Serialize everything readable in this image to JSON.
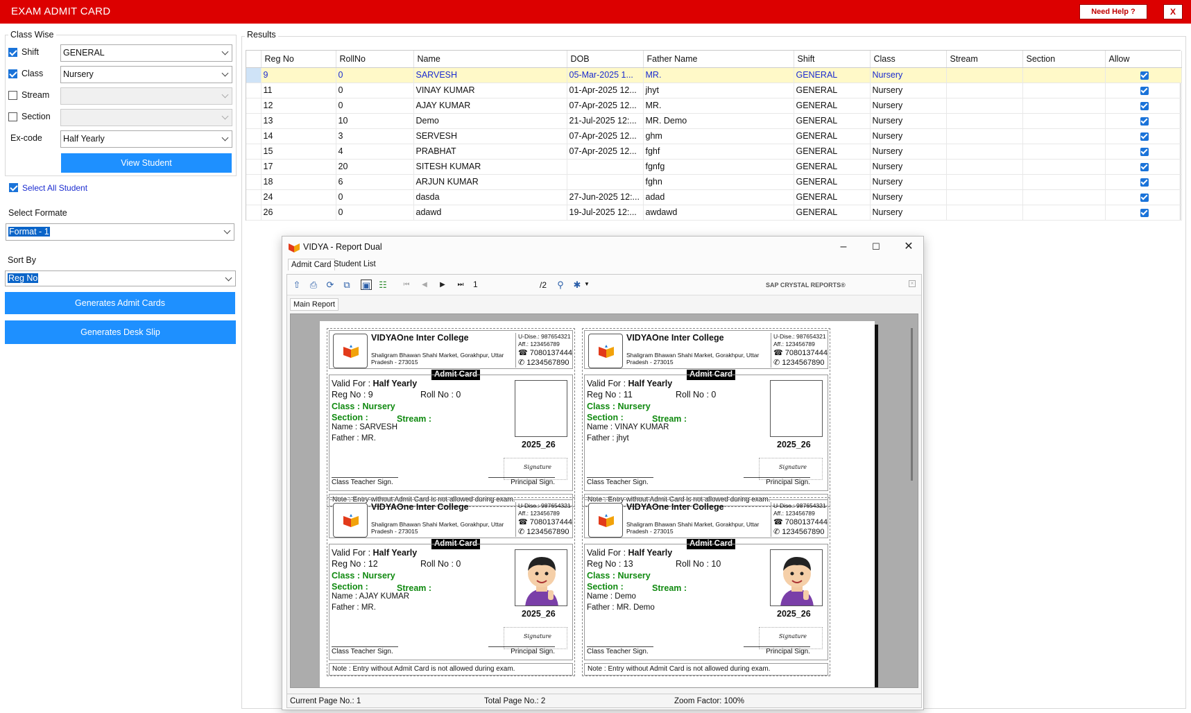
{
  "app": {
    "title": "EXAM ADMIT CARD",
    "help_label": "Need Help ?",
    "close_label": "X"
  },
  "filters": {
    "group_label": "Class Wise",
    "shift": {
      "label": "Shift",
      "value": "GENERAL",
      "checked": true
    },
    "class": {
      "label": "Class",
      "value": "Nursery",
      "checked": true
    },
    "stream": {
      "label": "Stream",
      "value": "",
      "checked": false
    },
    "section": {
      "label": "Section",
      "value": "",
      "checked": false
    },
    "excode": {
      "label": "Ex-code",
      "value": "Half Yearly"
    },
    "view_button": "View Student"
  },
  "select_all": {
    "label": "Select All Student",
    "checked": true
  },
  "format": {
    "label": "Select Formate",
    "value": "Format - 1"
  },
  "sort": {
    "label": "Sort By",
    "value": "Reg No"
  },
  "buttons": {
    "generate_admit": "Generates Admit Cards",
    "generate_desk": "Generates Desk Slip"
  },
  "results": {
    "label": "Results",
    "columns": [
      "Reg No",
      "RollNo",
      "Name",
      "DOB",
      "Father Name",
      "Shift",
      "Class",
      "Stream",
      "Section",
      "Allow"
    ],
    "rows": [
      [
        "9",
        "0",
        "SARVESH",
        "05-Mar-2025 1...",
        "MR.",
        "GENERAL",
        "Nursery",
        "",
        ""
      ],
      [
        "11",
        "0",
        "VINAY KUMAR",
        "01-Apr-2025 12...",
        "jhyt",
        "GENERAL",
        "Nursery",
        "",
        ""
      ],
      [
        "12",
        "0",
        "AJAY KUMAR",
        "07-Apr-2025 12...",
        "MR.",
        "GENERAL",
        "Nursery",
        "",
        ""
      ],
      [
        "13",
        "10",
        "Demo",
        "21-Jul-2025 12:...",
        "MR. Demo",
        "GENERAL",
        "Nursery",
        "",
        ""
      ],
      [
        "14",
        "3",
        "SERVESH",
        "07-Apr-2025 12...",
        "ghm",
        "GENERAL",
        "Nursery",
        "",
        ""
      ],
      [
        "15",
        "4",
        "PRABHAT",
        "07-Apr-2025 12...",
        "fghf",
        "GENERAL",
        "Nursery",
        "",
        ""
      ],
      [
        "17",
        "20",
        "SITESH KUMAR",
        "",
        "fgnfg",
        "GENERAL",
        "Nursery",
        "",
        ""
      ],
      [
        "18",
        "6",
        "ARJUN KUMAR",
        "",
        "fghn",
        "GENERAL",
        "Nursery",
        "",
        ""
      ],
      [
        "24",
        "0",
        "dasda",
        "27-Jun-2025 12:...",
        "adad",
        "GENERAL",
        "Nursery",
        "",
        ""
      ],
      [
        "26",
        "0",
        "adawd",
        "19-Jul-2025 12:...",
        "awdawd",
        "GENERAL",
        "Nursery",
        "",
        ""
      ]
    ]
  },
  "dialog": {
    "title": "VIDYA - Report Dual",
    "tabs": [
      "Admit Card",
      "Student List"
    ],
    "page_input": "1",
    "page_total": "/2",
    "brand": "SAP CRYSTAL REPORTS®",
    "main_report_tab": "Main Report",
    "status": {
      "current": "Current Page No.: 1",
      "total": "Total Page No.: 2",
      "zoom": "Zoom Factor: 100%"
    }
  },
  "card_common": {
    "college": "VIDYAOne Inter College",
    "address": "Shaligram Bhawan Shahi Market, Gorakhpur, Uttar Pradesh - 273015",
    "udise": "U-Dise.: 987654321",
    "aff": "Aff.: 123456789",
    "phone1": "7080137444",
    "phone2": "1234567890",
    "badge": "Admit Card",
    "valid_label": "Valid For : ",
    "valid_value": "Half Yearly",
    "class_label": "Class : Nursery",
    "section_label": "Section :",
    "stream_label": "Stream :",
    "year": "2025_26",
    "sign_script": "Signature",
    "teacher_sign": "Class Teacher Sign.",
    "principal_sign": "Principal Sign.",
    "note": "Note : Entry without Admit Card is not allowed during exam."
  },
  "cards": [
    {
      "reg": "Reg No : 9",
      "roll": "Roll No : 0",
      "name": "Name : SARVESH",
      "father": "Father : MR.",
      "photo": false
    },
    {
      "reg": "Reg No : 11",
      "roll": "Roll No : 0",
      "name": "Name : VINAY KUMAR",
      "father": "Father : jhyt",
      "photo": false
    },
    {
      "reg": "Reg No : 12",
      "roll": "Roll No : 0",
      "name": "Name : AJAY KUMAR",
      "father": "Father : MR.",
      "photo": true
    },
    {
      "reg": "Reg No : 13",
      "roll": "Roll No : 10",
      "name": "Name : Demo",
      "father": "Father : MR. Demo",
      "photo": true
    }
  ],
  "colors": {
    "topbar": "#dc0000",
    "button": "#1e90ff",
    "selected_row": "#fff9c8",
    "card_green": "#108a10"
  }
}
